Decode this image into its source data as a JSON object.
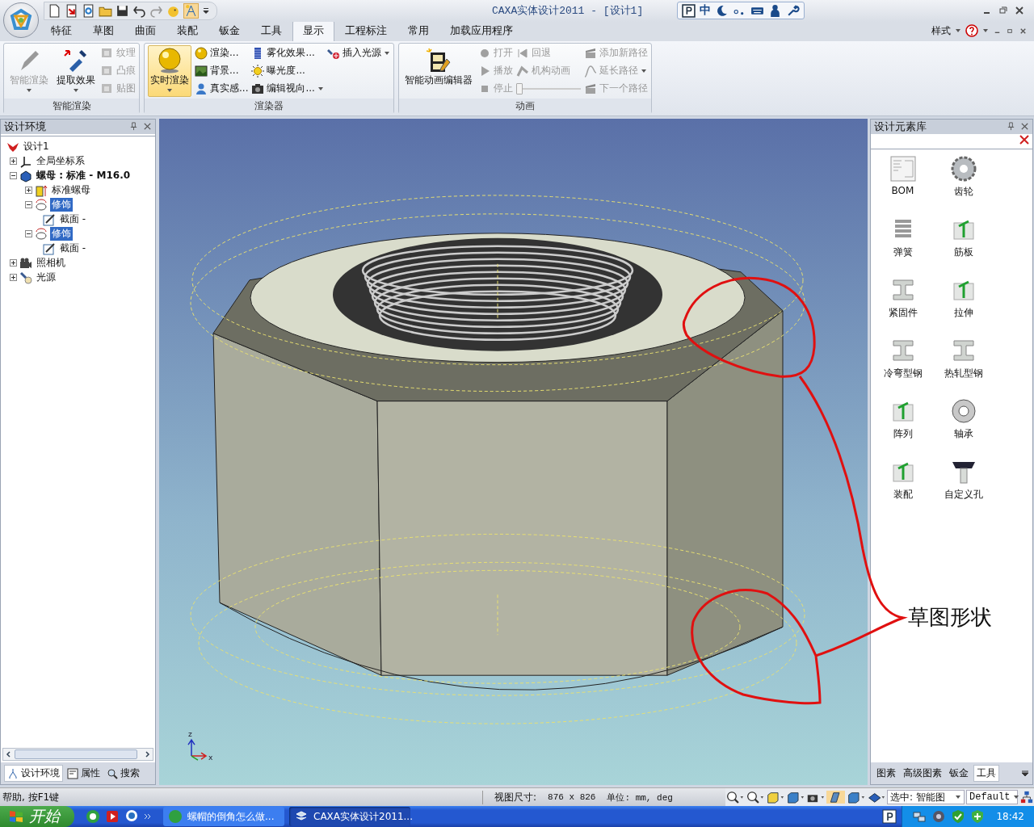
{
  "app_bar": {
    "title": "CAXA实体设计2011 - [设计1]",
    "ime_mode": "中"
  },
  "ribbon_tabs": [
    {
      "label": "特征",
      "selected": false
    },
    {
      "label": "草图",
      "selected": false
    },
    {
      "label": "曲面",
      "selected": false
    },
    {
      "label": "装配",
      "selected": false
    },
    {
      "label": "钣金",
      "selected": false
    },
    {
      "label": "工具",
      "selected": false
    },
    {
      "label": "显示",
      "selected": true
    },
    {
      "label": "工程标注",
      "selected": false
    },
    {
      "label": "常用",
      "selected": false
    },
    {
      "label": "加载应用程序",
      "selected": false
    }
  ],
  "ribbon_extras": {
    "style_menu": "样式"
  },
  "ribbon_groups": [
    {
      "title": "智能渲染",
      "columns": [
        [
          {
            "kind": "large",
            "label": "智能渲染",
            "disabled": true,
            "dropdown": true,
            "on": false
          }
        ],
        [
          {
            "kind": "large",
            "label": "提取效果",
            "disabled": false,
            "dropdown": true,
            "on": false
          }
        ],
        [
          {
            "kind": "small",
            "label": "纹理",
            "disabled": true,
            "dropdown": false,
            "on": false
          },
          {
            "kind": "small",
            "label": "凸痕",
            "disabled": true,
            "dropdown": false,
            "on": false
          },
          {
            "kind": "small",
            "label": "贴图",
            "disabled": true,
            "dropdown": false,
            "on": false
          }
        ]
      ]
    },
    {
      "title": "渲染器",
      "columns": [
        [
          {
            "kind": "large",
            "label": "实时渲染",
            "disabled": false,
            "dropdown": true,
            "on": true
          }
        ],
        [
          {
            "kind": "small",
            "label": "渲染...",
            "disabled": false,
            "dropdown": false,
            "on": false
          },
          {
            "kind": "small",
            "label": "背景...",
            "disabled": false,
            "dropdown": false,
            "on": false
          },
          {
            "kind": "small",
            "label": "真实感...",
            "disabled": false,
            "dropdown": false,
            "on": false
          }
        ],
        [
          {
            "kind": "small",
            "label": "雾化效果...",
            "disabled": false,
            "dropdown": false,
            "on": false
          },
          {
            "kind": "small",
            "label": "曝光度...",
            "disabled": false,
            "dropdown": false,
            "on": false
          },
          {
            "kind": "small",
            "label": "编辑视向...",
            "disabled": false,
            "dropdown": true,
            "on": false
          }
        ],
        [
          {
            "kind": "small",
            "label": "插入光源",
            "disabled": false,
            "dropdown": true,
            "on": false
          }
        ]
      ]
    },
    {
      "title": "动画",
      "columns": [
        [
          {
            "kind": "large",
            "label": "智能动画编辑器",
            "disabled": false,
            "dropdown": false,
            "on": false
          }
        ],
        [
          {
            "kind": "small",
            "label": "打开",
            "disabled": true,
            "dropdown": false,
            "on": false
          },
          {
            "kind": "small",
            "label": "播放",
            "disabled": true,
            "dropdown": false,
            "on": false
          },
          {
            "kind": "small",
            "label": "停止",
            "disabled": true,
            "dropdown": false,
            "on": false
          }
        ],
        [
          {
            "kind": "small",
            "label": "回退",
            "disabled": true,
            "dropdown": false,
            "on": false
          },
          {
            "kind": "small",
            "label": "机构动画",
            "disabled": true,
            "dropdown": false,
            "on": false
          },
          {
            "kind": "slider",
            "level": 0,
            "disabled": true
          }
        ],
        [
          {
            "kind": "small",
            "label": "添加新路径",
            "disabled": true,
            "dropdown": false,
            "on": false
          },
          {
            "kind": "small",
            "label": "延长路径",
            "disabled": true,
            "dropdown": true,
            "on": false
          },
          {
            "kind": "small",
            "label": "下一个路径",
            "disabled": true,
            "dropdown": false,
            "on": false
          }
        ]
      ]
    }
  ],
  "left_panel": {
    "title": "设计环境",
    "tree": [
      {
        "label": "设计1",
        "bold": false,
        "selected": false,
        "children": [
          {
            "label": "全局坐标系",
            "bold": false,
            "selected": false,
            "expanded": false
          },
          {
            "label": "螺母 : 标准 - M16.0",
            "bold": true,
            "selected": false,
            "expanded": true,
            "children": [
              {
                "label": "标准螺母",
                "bold": false,
                "selected": false,
                "expanded": false
              },
              {
                "label": "修饰",
                "bold": false,
                "selected": true,
                "expanded": true,
                "children": [
                  {
                    "label": "截面 -",
                    "bold": false,
                    "selected": false
                  }
                ]
              },
              {
                "label": "修饰",
                "bold": false,
                "selected": true,
                "expanded": true,
                "children": [
                  {
                    "label": "截面 -",
                    "bold": false,
                    "selected": false
                  }
                ]
              }
            ]
          },
          {
            "label": "照相机",
            "bold": false,
            "selected": false,
            "expanded": false
          },
          {
            "label": "光源",
            "bold": false,
            "selected": false,
            "expanded": false
          }
        ]
      }
    ],
    "tabs": [
      {
        "label": "设计环境",
        "selected": true
      },
      {
        "label": "属性",
        "selected": false
      },
      {
        "label": "搜索",
        "selected": false
      }
    ]
  },
  "viewport": {
    "axis_labels": [
      "z",
      "x"
    ],
    "callout": "草图形状"
  },
  "right_panel": {
    "title": "设计元素库",
    "items": [
      {
        "label": "BOM"
      },
      {
        "label": "齿轮"
      },
      {
        "label": "弹簧"
      },
      {
        "label": "筋板"
      },
      {
        "label": "紧固件"
      },
      {
        "label": "拉伸"
      },
      {
        "label": "冷弯型钢"
      },
      {
        "label": "热轧型钢"
      },
      {
        "label": "阵列"
      },
      {
        "label": "轴承"
      },
      {
        "label": "装配"
      },
      {
        "label": "自定义孔"
      }
    ],
    "tabs": [
      {
        "label": "图素",
        "selected": false
      },
      {
        "label": "高级图素",
        "selected": false
      },
      {
        "label": "钣金",
        "selected": false
      },
      {
        "label": "工具",
        "selected": true
      }
    ]
  },
  "status_bar": {
    "help": "帮助, 按F1键",
    "view_size_label": "视图尺寸:",
    "view_size": "876 x 826",
    "units": "单位: mm, deg",
    "selection_filter": "选中: 智能图",
    "style_dropdown": "Default"
  },
  "taskbar": {
    "start": "开始",
    "tasks": [
      {
        "label": "螺帽的倒角怎么做...",
        "selected": false
      },
      {
        "label": "CAXA实体设计2011...",
        "selected": true
      }
    ],
    "clock": "18:42"
  }
}
